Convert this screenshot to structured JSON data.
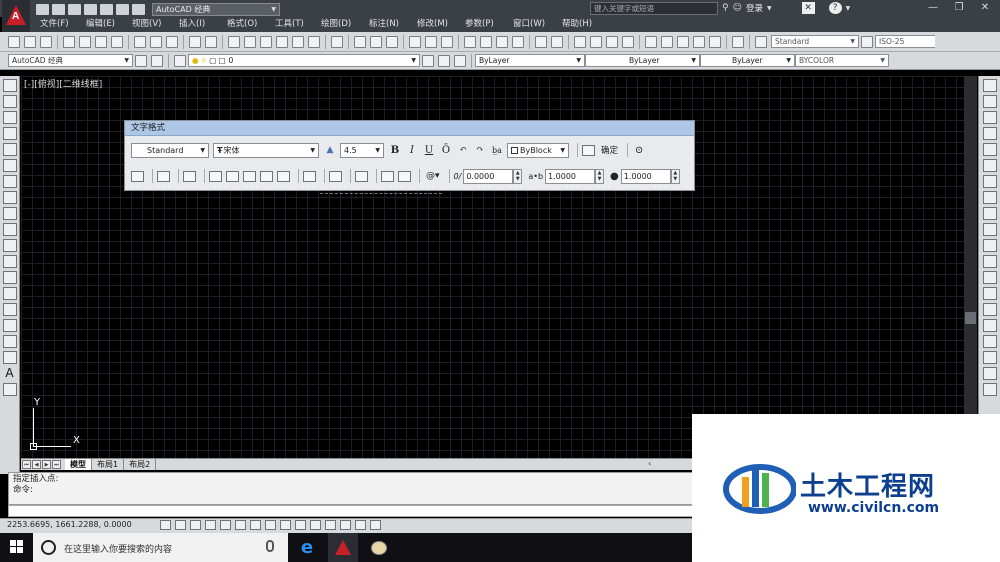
{
  "title_bar": {
    "workspace": "AutoCAD 经典",
    "search_placeholder": "键入关键字或短语",
    "login": "登录",
    "help": "?"
  },
  "menu": [
    "文件(F)",
    "编辑(E)",
    "视图(V)",
    "插入(I)",
    "格式(O)",
    "工具(T)",
    "绘图(D)",
    "标注(N)",
    "修改(M)",
    "参数(P)",
    "窗口(W)",
    "帮助(H)"
  ],
  "toolbar1": {
    "text_style": "Standard",
    "dim_style": "ISO-25"
  },
  "toolbar2": {
    "workspace": "AutoCAD 经典",
    "layer": "0",
    "color": "ByLayer",
    "linetype": "ByLayer",
    "lineweight": "ByLayer",
    "plot_style": "BYCOLOR"
  },
  "viewport_label": "[-][俯视][二维线框]",
  "text_formatting": {
    "title": "文字格式",
    "style": "Standard",
    "font": "宋体",
    "height": "4.5",
    "bold": "B",
    "italic": "I",
    "underline": "U",
    "overline": "Ō",
    "color": "ByBlock",
    "ok": "确定",
    "oblique": "0.0000",
    "tracking": "1.0000",
    "width_factor": "1.0000"
  },
  "ucs": {
    "y": "Y",
    "x": "X"
  },
  "layout_tabs": [
    "模型",
    "布局1",
    "布局2"
  ],
  "command": {
    "line1": "指定插入点:",
    "line2": "命令:"
  },
  "status": {
    "coords": "2253.6695,  1661.2288, 0.0000"
  },
  "taskbar": {
    "search_text": "在这里输入你要搜索的内容"
  },
  "watermark": {
    "brand": "土木工程网",
    "url": "www.civilcn.com"
  },
  "colors": {
    "dark_chrome": "#3b3f46",
    "panel_title": "#aec7e6",
    "watermark_blue": "#0d3f8f"
  }
}
